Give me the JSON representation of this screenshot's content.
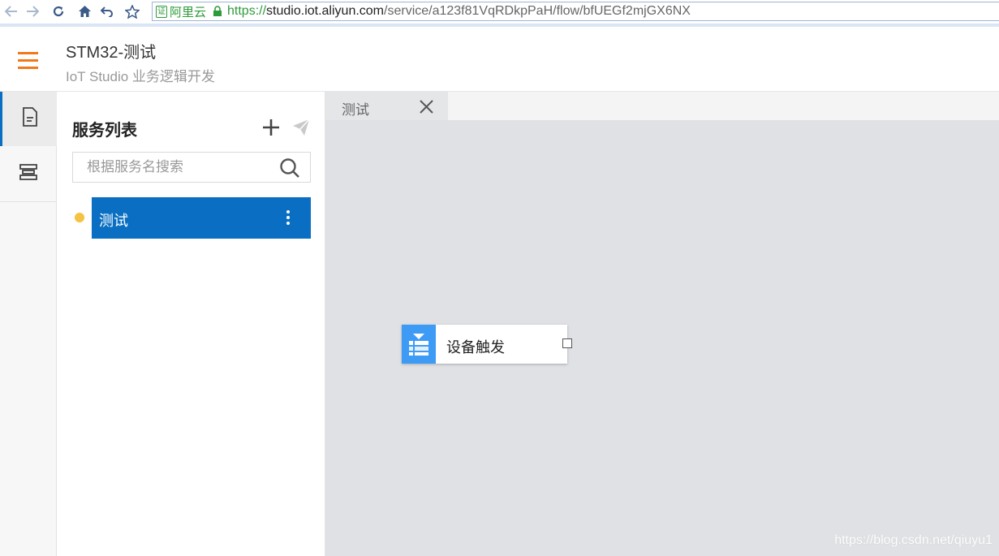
{
  "browser": {
    "back_icon": "arrow-left-icon",
    "forward_icon": "arrow-right-icon",
    "reload_icon": "reload-icon",
    "home_icon": "home-icon",
    "undo_icon": "undo-icon",
    "bookmark_icon": "star-icon",
    "cert_label": "阿里云",
    "url_scheme": "https://",
    "url_host": "studio.iot.aliyun.com",
    "url_path": "/service/a123f81VqRDkpPaH/flow/bfUEGf2mjGX6NX"
  },
  "header": {
    "title": "STM32-测试",
    "subtitle": "IoT Studio 业务逻辑开发",
    "accent_color": "#f07a1a"
  },
  "rail": {
    "items": [
      {
        "icon": "document-icon",
        "active": true
      },
      {
        "icon": "service-stack-icon",
        "active": false
      }
    ]
  },
  "service_panel": {
    "title": "服务列表",
    "search_placeholder": "根据服务名搜索",
    "search_value": "",
    "items": [
      {
        "label": "测试",
        "status_color": "#f5c242",
        "selected": true
      }
    ],
    "selected_color": "#0a6fc2"
  },
  "editor": {
    "tabs": [
      {
        "label": "测试"
      }
    ],
    "nodes": [
      {
        "label": "设备触发",
        "icon": "device-trigger-icon",
        "color": "#3d9bf5"
      }
    ]
  },
  "watermark": "https://blog.csdn.net/qiuyu1"
}
